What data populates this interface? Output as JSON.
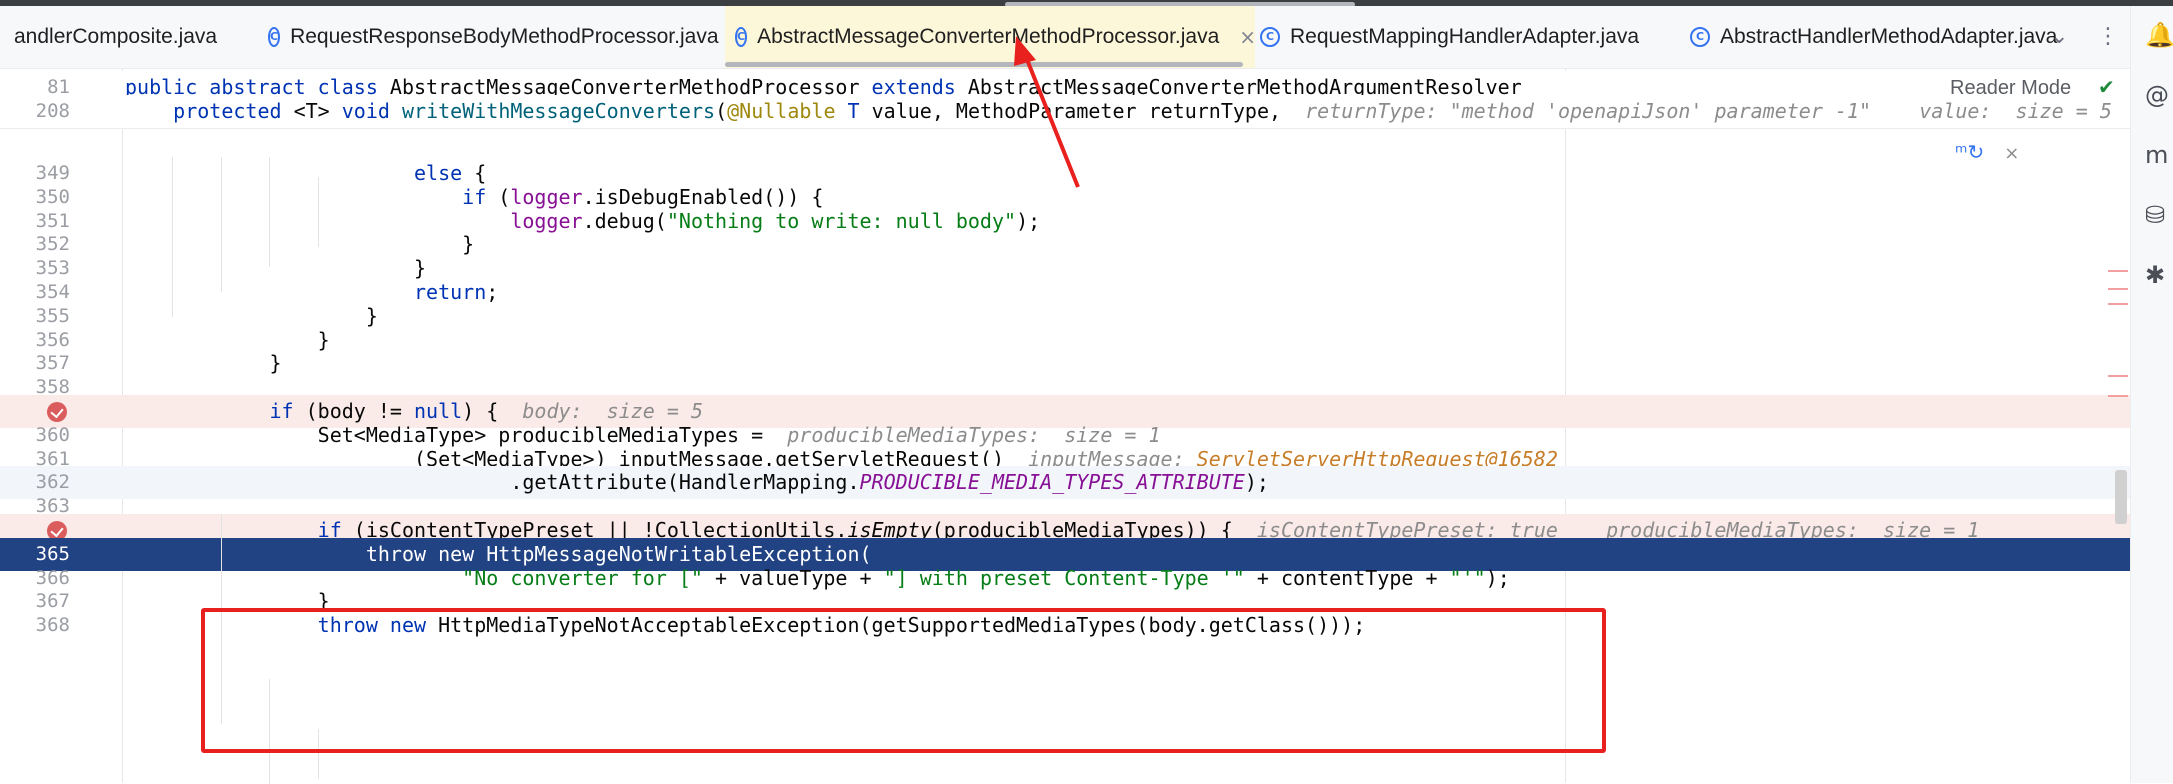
{
  "tabs": [
    {
      "label": "andlerComposite.java",
      "icon": "class-icon",
      "active": false
    },
    {
      "label": "RequestResponseBodyMethodProcessor.java",
      "icon": "class-icon",
      "active": false
    },
    {
      "label": "AbstractMessageConverterMethodProcessor.java",
      "icon": "class-icon",
      "active": true
    },
    {
      "label": "RequestMappingHandlerAdapter.java",
      "icon": "class-icon",
      "active": false
    },
    {
      "label": "AbstractHandlerMethodAdapter.java",
      "icon": "class-icon",
      "active": false
    }
  ],
  "tab_class_glyph": "C",
  "tab_close_glyph": "×",
  "tab_controls": {
    "dropdown": "⌄",
    "more": "⋮"
  },
  "reader_mode": "Reader Mode",
  "check_glyph": "✔",
  "popup": {
    "icon": "ᵐ↻",
    "close": "×"
  },
  "sticky": [
    {
      "ln": "81",
      "parts": [
        [
          "kw",
          "public abstract class "
        ],
        [
          "",
          "AbstractMessageConverterMethodProcessor "
        ],
        [
          "kw",
          "extends "
        ],
        [
          "",
          "AbstractMessageConverterMethodArgumentResolver"
        ]
      ]
    },
    {
      "ln": "208",
      "parts": [
        [
          "",
          "    "
        ],
        [
          "kw",
          "protected "
        ],
        [
          "",
          "<T> "
        ],
        [
          "kw",
          "void "
        ],
        [
          "fn",
          "writeWithMessageConverters"
        ],
        [
          "",
          "("
        ],
        [
          "ann",
          "@Nullable "
        ],
        [
          "kw",
          "T "
        ],
        [
          "",
          "value, MethodParameter returnType,  "
        ],
        [
          "hint",
          "returnType: \"method 'openapiJson' parameter -1\"    value:  size = 5"
        ]
      ]
    }
  ],
  "lines": [
    {
      "ln": "349",
      "parts": [
        [
          "",
          "                        "
        ],
        [
          "kw",
          "else "
        ],
        [
          "",
          "{"
        ]
      ]
    },
    {
      "ln": "350",
      "parts": [
        [
          "",
          "                            "
        ],
        [
          "kw",
          "if "
        ],
        [
          "",
          "("
        ],
        [
          "fld",
          "logger"
        ],
        [
          "",
          ".isDebugEnabled()) {"
        ]
      ]
    },
    {
      "ln": "351",
      "parts": [
        [
          "",
          "                                "
        ],
        [
          "fld",
          "logger"
        ],
        [
          "",
          ".debug("
        ],
        [
          "str",
          "\"Nothing to write: null body\""
        ],
        [
          "",
          ");"
        ]
      ]
    },
    {
      "ln": "352",
      "parts": [
        [
          "",
          "                            }"
        ]
      ]
    },
    {
      "ln": "353",
      "parts": [
        [
          "",
          "                        }"
        ]
      ]
    },
    {
      "ln": "354",
      "parts": [
        [
          "",
          "                        "
        ],
        [
          "kw",
          "return"
        ],
        [
          "",
          ";"
        ]
      ]
    },
    {
      "ln": "355",
      "parts": [
        [
          "",
          "                    }"
        ]
      ]
    },
    {
      "ln": "356",
      "parts": [
        [
          "",
          "                }"
        ]
      ]
    },
    {
      "ln": "357",
      "parts": [
        [
          "",
          "            }"
        ]
      ]
    },
    {
      "ln": "358",
      "parts": [
        [
          "",
          ""
        ]
      ]
    },
    {
      "ln": "",
      "bp": true,
      "parts": [
        [
          "",
          "            "
        ],
        [
          "kw",
          "if "
        ],
        [
          "",
          "(body != "
        ],
        [
          "kw",
          "null"
        ],
        [
          "",
          ") {  "
        ],
        [
          "hint",
          "body:  size = 5"
        ]
      ]
    },
    {
      "ln": "360",
      "parts": [
        [
          "",
          "                Set<MediaType> producibleMediaTypes =  "
        ],
        [
          "hint",
          "producibleMediaTypes:  size = 1"
        ]
      ]
    },
    {
      "ln": "361",
      "parts": [
        [
          "",
          "                        (Set<MediaType>) inputMessage.getServletRequest()  "
        ],
        [
          "hint",
          "inputMessage: "
        ],
        [
          "obj",
          "ServletServerHttpRequest@16582"
        ]
      ]
    },
    {
      "ln": "362",
      "cur": true,
      "parts": [
        [
          "",
          "                                .getAttribute(HandlerMapping."
        ],
        [
          "fld italic",
          "PRODUCIBLE_MEDIA_TYPES_ATTRIBUTE"
        ],
        [
          "",
          ");"
        ]
      ]
    },
    {
      "ln": "363",
      "parts": [
        [
          "",
          ""
        ]
      ]
    },
    {
      "ln": "",
      "bp": true,
      "parts": [
        [
          "",
          "                "
        ],
        [
          "kw",
          "if "
        ],
        [
          "",
          "(isContentTypePreset || !CollectionUtils."
        ],
        [
          "italic",
          "isEmpty"
        ],
        [
          "",
          "(producibleMediaTypes)) {  "
        ],
        [
          "hint",
          "isContentTypePreset: true    producibleMediaTypes:  size = 1"
        ]
      ]
    },
    {
      "ln": "365",
      "sel": true,
      "parts": [
        [
          "",
          "                    "
        ],
        [
          "kw",
          "throw new "
        ],
        [
          "",
          "HttpMessageNotWritableException("
        ]
      ]
    },
    {
      "ln": "366",
      "parts": [
        [
          "",
          "                            "
        ],
        [
          "str",
          "\"No converter for [\""
        ],
        [
          "",
          " + valueType + "
        ],
        [
          "str",
          "\"] with preset Content-Type '\""
        ],
        [
          "",
          " + contentType + "
        ],
        [
          "str",
          "\"'\""
        ],
        [
          "",
          ");"
        ]
      ]
    },
    {
      "ln": "367",
      "parts": [
        [
          "",
          "                }"
        ]
      ]
    },
    {
      "ln": "368",
      "parts": [
        [
          "",
          "                "
        ],
        [
          "kw",
          "throw new "
        ],
        [
          "",
          "HttpMediaTypeNotAcceptableException(getSupportedMediaTypes(body.getClass()));"
        ]
      ]
    }
  ],
  "right_toolbar": [
    {
      "icon": "notifications-icon",
      "glyph": "🔔"
    },
    {
      "icon": "ai-assistant-icon",
      "glyph": "@"
    },
    {
      "icon": "maven-icon",
      "glyph": "m"
    },
    {
      "icon": "database-icon",
      "glyph": "⛁"
    },
    {
      "icon": "plugin-icon",
      "glyph": "✱"
    }
  ],
  "colors": {
    "selection": "#214283",
    "breakpoint_row": "#faeae8",
    "annotation_box": "#e8201e"
  }
}
